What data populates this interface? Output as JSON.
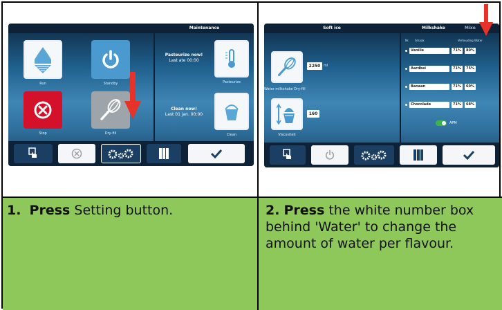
{
  "steps": [
    {
      "number": "1.",
      "action": "Press",
      "text": "Setting button.",
      "screen": {
        "title": "Maintenance",
        "tiles": [
          "Run",
          "Standby",
          "Stop",
          "Dry-fill"
        ],
        "messages": [
          {
            "heading": "Pasteurize now!",
            "detail": "Last ate 00:00",
            "label": "Pasteurize"
          },
          {
            "heading": "Clean now!",
            "detail": "Last 01 jan. 00:00",
            "label": "Clean"
          }
        ]
      }
    },
    {
      "number": "2.",
      "action": "Press",
      "text": "the white number box behind 'Water' to change the amount of water per flavour.",
      "screen": {
        "left_title": "Soft ice",
        "right_title": "Milkshake",
        "right_title_extra": "Mixe",
        "water_value": "2250",
        "water_unit": "ml",
        "water_label": "Water milkshake Dry-fill",
        "viscosity_value": "160",
        "viscosity_label": "Viscositeit",
        "columns": [
          "Nr.",
          "Smaak",
          "Verhouding",
          "Water"
        ],
        "flavours": [
          {
            "name": "Vanille",
            "ratio": "71%",
            "water": "80%"
          },
          {
            "name": "Aardbei",
            "ratio": "71%",
            "water": "75%"
          },
          {
            "name": "Banaan",
            "ratio": "71%",
            "water": "60%"
          },
          {
            "name": "Chocolade",
            "ratio": "71%",
            "water": "68%"
          }
        ],
        "toggle_label": "APM"
      }
    }
  ],
  "colors": {
    "green_cell": "#8fc85a",
    "arrow": "#e63228",
    "screen_bar": "#0d2236",
    "accent_blue": "#4a9ad0"
  }
}
